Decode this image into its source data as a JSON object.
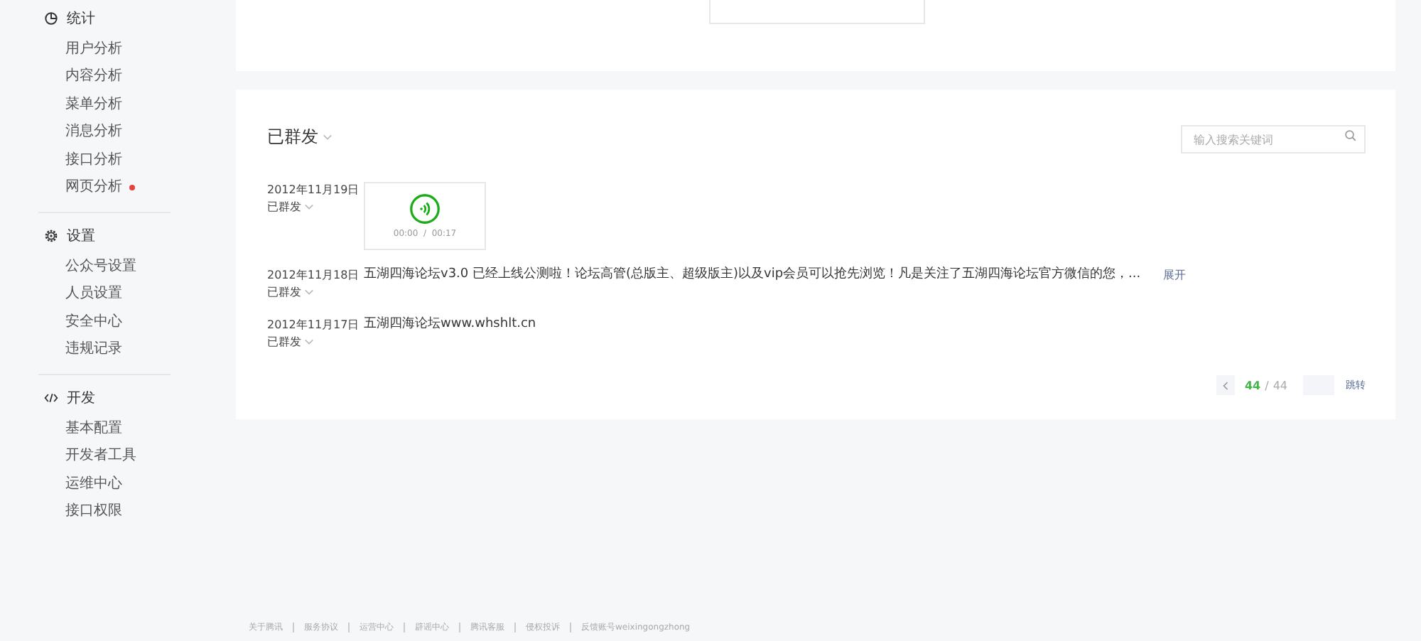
{
  "sidebar": {
    "groups": [
      {
        "title": "统计",
        "items": [
          {
            "label": "用户分析",
            "new": false
          },
          {
            "label": "内容分析",
            "new": false
          },
          {
            "label": "菜单分析",
            "new": false
          },
          {
            "label": "消息分析",
            "new": false
          },
          {
            "label": "接口分析",
            "new": false
          },
          {
            "label": "网页分析",
            "new": true
          }
        ]
      },
      {
        "title": "设置",
        "items": [
          {
            "label": "公众号设置",
            "new": false
          },
          {
            "label": "人员设置",
            "new": false
          },
          {
            "label": "安全中心",
            "new": false
          },
          {
            "label": "违规记录",
            "new": false
          }
        ]
      },
      {
        "title": "开发",
        "items": [
          {
            "label": "基本配置",
            "new": false
          },
          {
            "label": "开发者工具",
            "new": false
          },
          {
            "label": "运维中心",
            "new": false
          },
          {
            "label": "接口权限",
            "new": false
          }
        ]
      }
    ]
  },
  "messages_panel": {
    "filter": "已群发",
    "search": {
      "placeholder": "输入搜索关键词"
    },
    "messages": [
      {
        "kind": "voice",
        "date": "2012年11月19日",
        "status": "已群发",
        "time": "00:00  /  00:17"
      },
      {
        "kind": "text",
        "date": "2012年11月18日",
        "status": "已群发",
        "text": "五湖四海论坛v3.0 已经上线公测啦！论坛高管(总版主、超级版主)以及vip会员可以抢先浏览！凡是关注了五湖四海论坛官方微信的您，...",
        "expand": "展开"
      },
      {
        "kind": "text",
        "date": "2012年11月17日",
        "status": "已群发",
        "text": "五湖四海论坛www.whshlt.cn"
      }
    ],
    "pagination": {
      "current": "44",
      "separator": "/",
      "total": "44",
      "jump": "跳转"
    }
  },
  "footer": [
    "关于腾讯",
    "服务协议",
    "运营中心",
    "辟谣中心",
    "腾讯客服",
    "侵权投诉",
    "反馈账号weixingongzhong"
  ]
}
